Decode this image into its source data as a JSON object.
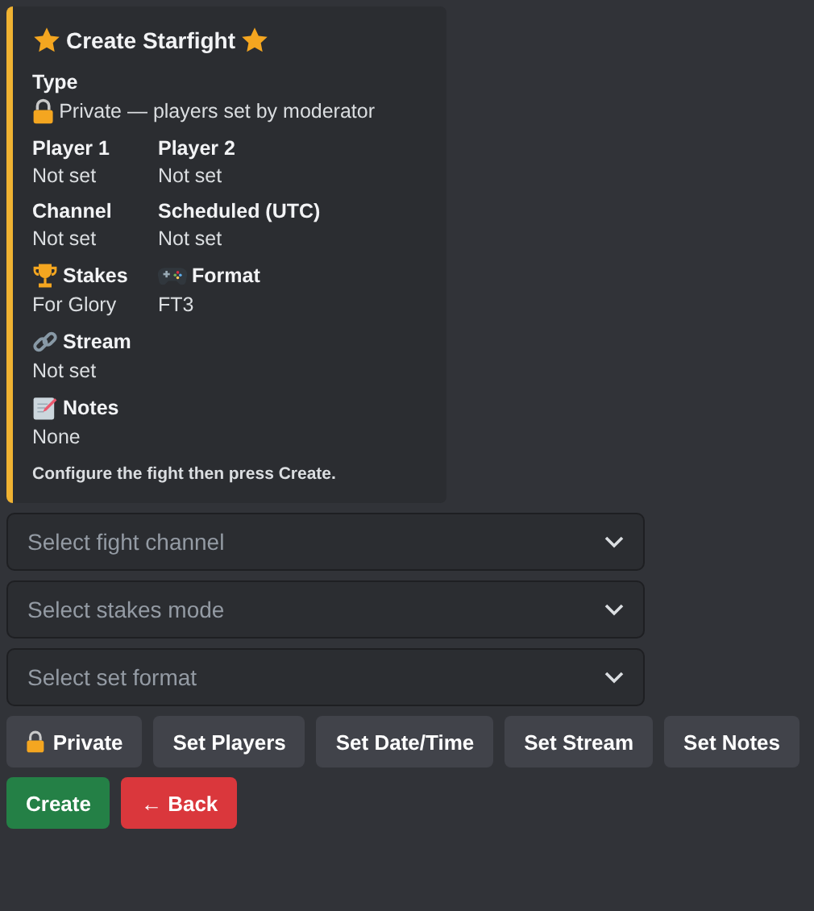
{
  "embed": {
    "title": "Create Starfight",
    "field_rows": [
      [
        {
          "name": "Type",
          "value": "Private — players set by moderator",
          "kind": "locked"
        }
      ],
      [
        {
          "name": "Player 1",
          "value": "Not set",
          "kind": "plain"
        },
        {
          "name": "Player 2",
          "value": "Not set",
          "kind": "plain"
        }
      ],
      [
        {
          "name": "Channel",
          "value": "Not set",
          "kind": "plain"
        },
        {
          "name": "Scheduled (UTC)",
          "value": "Not set",
          "kind": "plain"
        }
      ],
      [
        {
          "name": "Stakes",
          "value": "For Glory",
          "kind": "trophy"
        },
        {
          "name": "Format",
          "value": "FT3",
          "kind": "gamepad"
        }
      ],
      [
        {
          "name": "Stream",
          "value": "Not set",
          "kind": "link"
        }
      ],
      [
        {
          "name": "Notes",
          "value": "None",
          "kind": "memo"
        }
      ]
    ],
    "footer": "Configure the fight then press Create."
  },
  "selects": [
    {
      "placeholder": "Select fight channel"
    },
    {
      "placeholder": "Select stakes mode"
    },
    {
      "placeholder": "Select set format"
    }
  ],
  "button_rows": [
    [
      {
        "label": "Private",
        "kind": "locked"
      },
      {
        "label": "Set Players",
        "kind": "secondary"
      },
      {
        "label": "Set Date/Time",
        "kind": "secondary"
      },
      {
        "label": "Set Stream",
        "kind": "secondary"
      },
      {
        "label": "Set Notes",
        "kind": "secondary"
      }
    ],
    [
      {
        "label": "Create",
        "kind": "success"
      },
      {
        "label": "← Back",
        "kind": "danger"
      }
    ]
  ]
}
